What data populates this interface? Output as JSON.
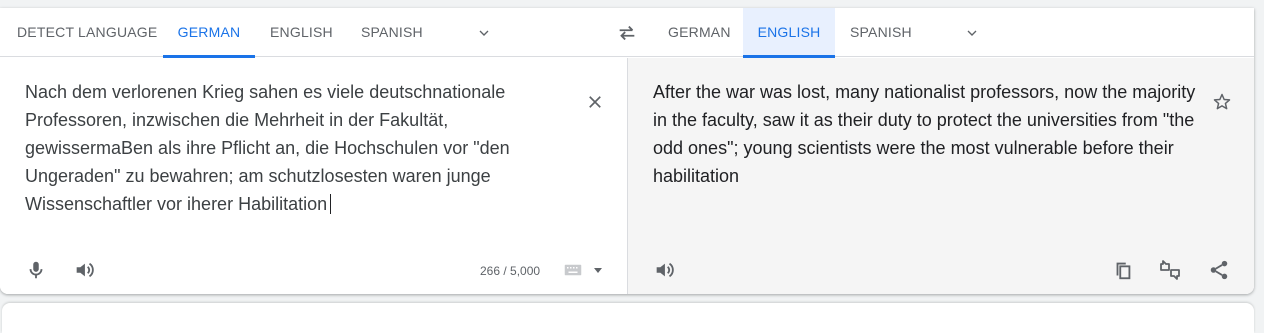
{
  "source_langs": {
    "tabs": [
      "DETECT LANGUAGE",
      "GERMAN",
      "ENGLISH",
      "SPANISH"
    ],
    "active": "GERMAN",
    "more_icon": "chevron-down-icon"
  },
  "swap_icon": "swap-icon",
  "target_langs": {
    "tabs": [
      "GERMAN",
      "ENGLISH",
      "SPANISH"
    ],
    "active": "ENGLISH",
    "more_icon": "chevron-down-icon"
  },
  "source": {
    "text": "Nach dem verlorenen Krieg sahen es viele deutschnationale Professoren, inzwischen die Mehrheit in der Fakultät, gewissermaBen als ihre Pflicht an, die Hochschulen vor \"den Ungeraden\" zu bewahren; am schutzlosesten waren junge Wissenschaftler vor iherer Habilitation",
    "char_count": "266 / 5,000",
    "icons": [
      "close-icon",
      "mic-icon",
      "speaker-icon",
      "keyboard-icon",
      "dropdown-arrow-icon"
    ]
  },
  "target": {
    "text": "After the war was lost, many nationalist professors, now the majority in the faculty, saw it as their duty to protect the universities from \"the odd ones\"; young scientists were the most vulnerable before their habilitation",
    "icons": [
      "star-icon",
      "speaker-icon",
      "copy-icon",
      "feedback-icon",
      "share-icon"
    ]
  },
  "colors": {
    "accent": "#1a73e8",
    "text": "#3c4043",
    "muted": "#5f6368",
    "target_bg": "#f5f5f5"
  }
}
